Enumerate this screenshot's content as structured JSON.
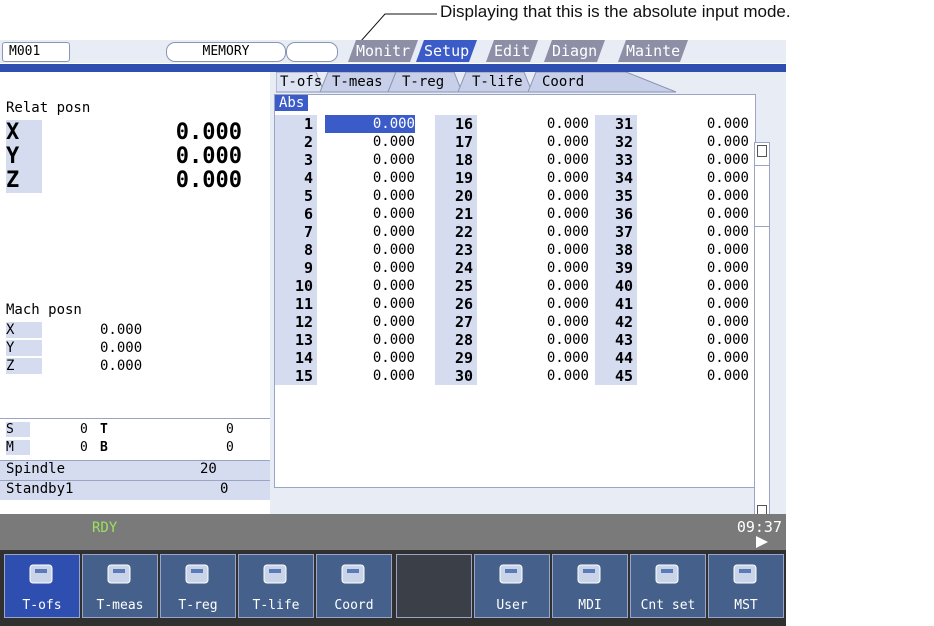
{
  "annotation": "Displaying that this is the absolute input mode.",
  "topbar": {
    "mode": "M001",
    "status": "MEMORY",
    "tabs": [
      "Monitr",
      "Setup",
      "Edit",
      "Diagn",
      "Mainte"
    ],
    "active_tab": "Setup"
  },
  "subtabs": [
    "T-ofs",
    "T-meas",
    "T-reg",
    "T-life",
    "Coord"
  ],
  "active_subtab": "T-ofs",
  "relat": {
    "title": "Relat posn",
    "axes": [
      {
        "axis": "X",
        "value": "0.000"
      },
      {
        "axis": "Y",
        "value": "0.000"
      },
      {
        "axis": "Z",
        "value": "0.000"
      }
    ]
  },
  "mach": {
    "title": "Mach posn",
    "axes": [
      {
        "axis": "X",
        "value": "0.000"
      },
      {
        "axis": "Y",
        "value": "0.000"
      },
      {
        "axis": "Z",
        "value": "0.000"
      }
    ]
  },
  "smtb": [
    {
      "label1": "S",
      "value1": "0",
      "label2": "T",
      "value2": "0"
    },
    {
      "label1": "M",
      "value1": "0",
      "label2": "B",
      "value2": "0"
    }
  ],
  "spindle": {
    "label": "Spindle",
    "value": "20"
  },
  "standby": {
    "label": "Standby1",
    "value": "0"
  },
  "table": {
    "mode_label": "Abs",
    "columns": [
      {
        "nums": [
          "1",
          "2",
          "3",
          "4",
          "5",
          "6",
          "7",
          "8",
          "9",
          "10",
          "11",
          "12",
          "13",
          "14",
          "15"
        ],
        "values": [
          "0.000",
          "0.000",
          "0.000",
          "0.000",
          "0.000",
          "0.000",
          "0.000",
          "0.000",
          "0.000",
          "0.000",
          "0.000",
          "0.000",
          "0.000",
          "0.000",
          "0.000"
        ]
      },
      {
        "nums": [
          "16",
          "17",
          "18",
          "19",
          "20",
          "21",
          "22",
          "23",
          "24",
          "25",
          "26",
          "27",
          "28",
          "29",
          "30"
        ],
        "values": [
          "0.000",
          "0.000",
          "0.000",
          "0.000",
          "0.000",
          "0.000",
          "0.000",
          "0.000",
          "0.000",
          "0.000",
          "0.000",
          "0.000",
          "0.000",
          "0.000",
          "0.000"
        ]
      },
      {
        "nums": [
          "31",
          "32",
          "33",
          "34",
          "35",
          "36",
          "37",
          "38",
          "39",
          "40",
          "41",
          "42",
          "43",
          "44",
          "45"
        ],
        "values": [
          "0.000",
          "0.000",
          "0.000",
          "0.000",
          "0.000",
          "0.000",
          "0.000",
          "0.000",
          "0.000",
          "0.000",
          "0.000",
          "0.000",
          "0.000",
          "0.000",
          "0.000"
        ]
      }
    ]
  },
  "status": {
    "rdy": "RDY",
    "time": "09:37"
  },
  "softkeys": [
    {
      "label": "T-ofs",
      "icon": "tool-offset-icon"
    },
    {
      "label": "T-meas",
      "icon": "tool-measure-icon"
    },
    {
      "label": "T-reg",
      "icon": "tool-register-icon"
    },
    {
      "label": "T-life",
      "icon": "tool-life-icon"
    },
    {
      "label": "Coord",
      "icon": "coordinate-icon"
    },
    {
      "label": "",
      "icon": ""
    },
    {
      "label": "User",
      "icon": "user-parameter-icon"
    },
    {
      "label": "MDI",
      "icon": "hand-icon"
    },
    {
      "label": "Cnt set",
      "icon": "counter-set-icon"
    },
    {
      "label": "MST",
      "icon": "mst-icon"
    }
  ],
  "colors": {
    "accent": "#3a5bc8",
    "band": "#2e4fb0",
    "rdy": "#9ae15f"
  }
}
